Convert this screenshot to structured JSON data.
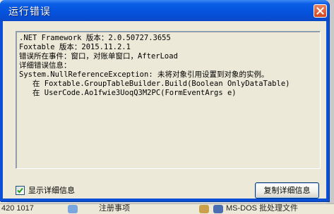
{
  "dialog": {
    "title": "运行错误",
    "close_icon": "close-icon",
    "message_lines": [
      ".NET Framework 版本：2.0.50727.3655",
      "Foxtable 版本：2015.11.2.1",
      "错误所在事件：窗口，对账单窗口，AfterLoad",
      "详细错误信息：",
      "System.NullReferenceException: 未将对象引用设置到对象的实例。",
      "   在 Foxtable.GroupTableBuilder.Build(Boolean OnlyDataTable)",
      "   在 UserCode.Ao1fwie3UoqQ3M2PC(FormEventArgs e)"
    ],
    "show_details_checked": true,
    "show_details_label": "显示详细信息",
    "copy_button_label": "复制详细信息"
  },
  "background": {
    "taskbar_text_left": "420 1017",
    "taskbar_text_mid": "注册事项",
    "taskbar_text_right": "MS-DOS 批处理文件",
    "edge_fragments": [
      "a",
      "1",
      "1",
      "1",
      "p",
      "P"
    ]
  },
  "colors": {
    "titlebar": "#0552dc",
    "client": "#ece9d8",
    "close_button": "#d4441d",
    "check_mark": "#21a121"
  }
}
